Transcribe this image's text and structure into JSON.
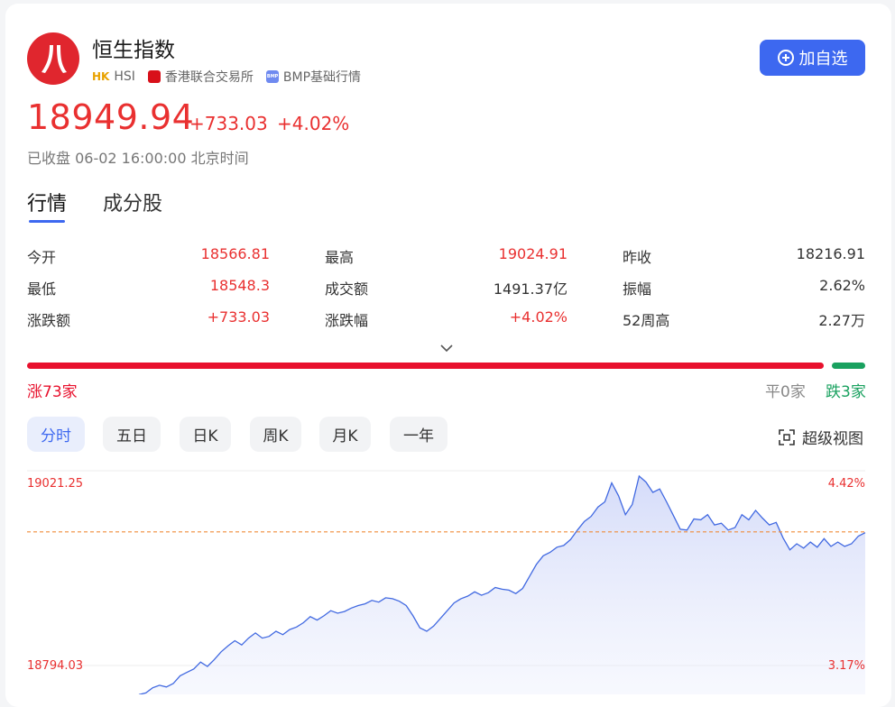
{
  "header": {
    "title": "恒生指数",
    "market_tag": "HK",
    "symbol": "HSI",
    "exchange": "香港联合交易所",
    "data_source_badge": "BMP",
    "data_source": "BMP基础行情",
    "add_button": "加自选"
  },
  "quote": {
    "price": "18949.94",
    "change": "+733.03",
    "change_pct": "+4.02%",
    "status": "已收盘 06-02 16:00:00 北京时间"
  },
  "tabs": [
    "行情",
    "成分股"
  ],
  "stats": [
    {
      "label": "今开",
      "value": "18566.81",
      "color": "red"
    },
    {
      "label": "最高",
      "value": "19024.91",
      "color": "red"
    },
    {
      "label": "昨收",
      "value": "18216.91",
      "color": "dark"
    },
    {
      "label": "最低",
      "value": "18548.3",
      "color": "red"
    },
    {
      "label": "成交额",
      "value": "1491.37亿",
      "color": "dark"
    },
    {
      "label": "振幅",
      "value": "2.62%",
      "color": "dark"
    },
    {
      "label": "涨跌额",
      "value": "+733.03",
      "color": "red"
    },
    {
      "label": "涨跌幅",
      "value": "+4.02%",
      "color": "red"
    },
    {
      "label": "52周高",
      "value": "2.27万",
      "color": "dark"
    }
  ],
  "breadth": {
    "rise": "涨73家",
    "flat": "平0家",
    "fall": "跌3家"
  },
  "period_tabs": [
    "分时",
    "五日",
    "日K",
    "周K",
    "月K",
    "一年"
  ],
  "fullscreen": "超级视图",
  "colors": {
    "up": "#e93030",
    "down": "#19a15f",
    "accent": "#3d68f0",
    "line": "#4169e1",
    "ref": "#f08c3a"
  },
  "chart_data": {
    "type": "area",
    "title": "",
    "y_left_ticks": [
      "19021.25",
      "18794.03"
    ],
    "y_right_ticks": [
      "4.42%",
      "3.17%"
    ],
    "ylim": [
      18760,
      19060
    ],
    "reference_line": 18949.94,
    "values": [
      18760,
      18762,
      18768,
      18771,
      18769,
      18773,
      18782,
      18786,
      18790,
      18798,
      18793,
      18801,
      18810,
      18817,
      18823,
      18818,
      18826,
      18832,
      18826,
      18828,
      18834,
      18830,
      18836,
      18839,
      18844,
      18851,
      18847,
      18852,
      18858,
      18855,
      18857,
      18861,
      18864,
      18866,
      18870,
      18868,
      18873,
      18872,
      18869,
      18864,
      18852,
      18838,
      18834,
      18840,
      18849,
      18858,
      18867,
      18872,
      18875,
      18880,
      18876,
      18879,
      18885,
      18883,
      18882,
      18878,
      18884,
      18898,
      18912,
      18922,
      18926,
      18932,
      18934,
      18941,
      18952,
      18962,
      18968,
      18979,
      18985,
      19007,
      18992,
      18970,
      18982,
      19015,
      19008,
      18996,
      19000,
      18985,
      18969,
      18953,
      18952,
      18965,
      18964,
      18970,
      18958,
      18960,
      18952,
      18955,
      18970,
      18964,
      18975,
      18966,
      18958,
      18961,
      18943,
      18929,
      18936,
      18931,
      18938,
      18932,
      18942,
      18933,
      18938,
      18933,
      18936,
      18945,
      18949
    ]
  }
}
